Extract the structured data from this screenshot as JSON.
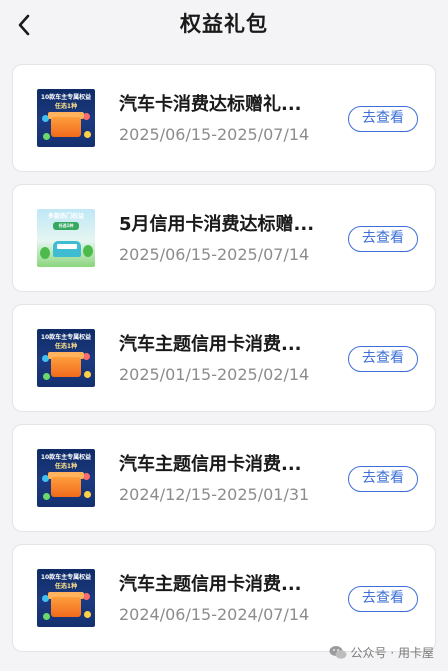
{
  "header": {
    "title": "权益礼包",
    "back_icon": "chevron-left-icon"
  },
  "thumbs": {
    "car_line1": "10款车主专属权益",
    "car_line2": "任选1种",
    "multi_line1": "多款热门权益",
    "multi_line2": "任选1种"
  },
  "cards": [
    {
      "name": "汽车卡消费达标赠礼...",
      "date": "2025/06/15-2025/07/14",
      "button": "去查看",
      "thumb": "car"
    },
    {
      "name": "5月信用卡消费达标赠...",
      "date": "2025/06/15-2025/07/14",
      "button": "去查看",
      "thumb": "multi"
    },
    {
      "name": "汽车主题信用卡消费...",
      "date": "2025/01/15-2025/02/14",
      "button": "去查看",
      "thumb": "car"
    },
    {
      "name": "汽车主题信用卡消费...",
      "date": "2024/12/15-2025/01/31",
      "button": "去查看",
      "thumb": "car"
    },
    {
      "name": "汽车主题信用卡消费...",
      "date": "2024/06/15-2024/07/14",
      "button": "去查看",
      "thumb": "car"
    }
  ],
  "watermark": {
    "text": "公众号 · 用卡屋",
    "icon": "wechat-icon"
  },
  "colors": {
    "accent": "#3d6fd6",
    "background": "#f4f4f6"
  }
}
